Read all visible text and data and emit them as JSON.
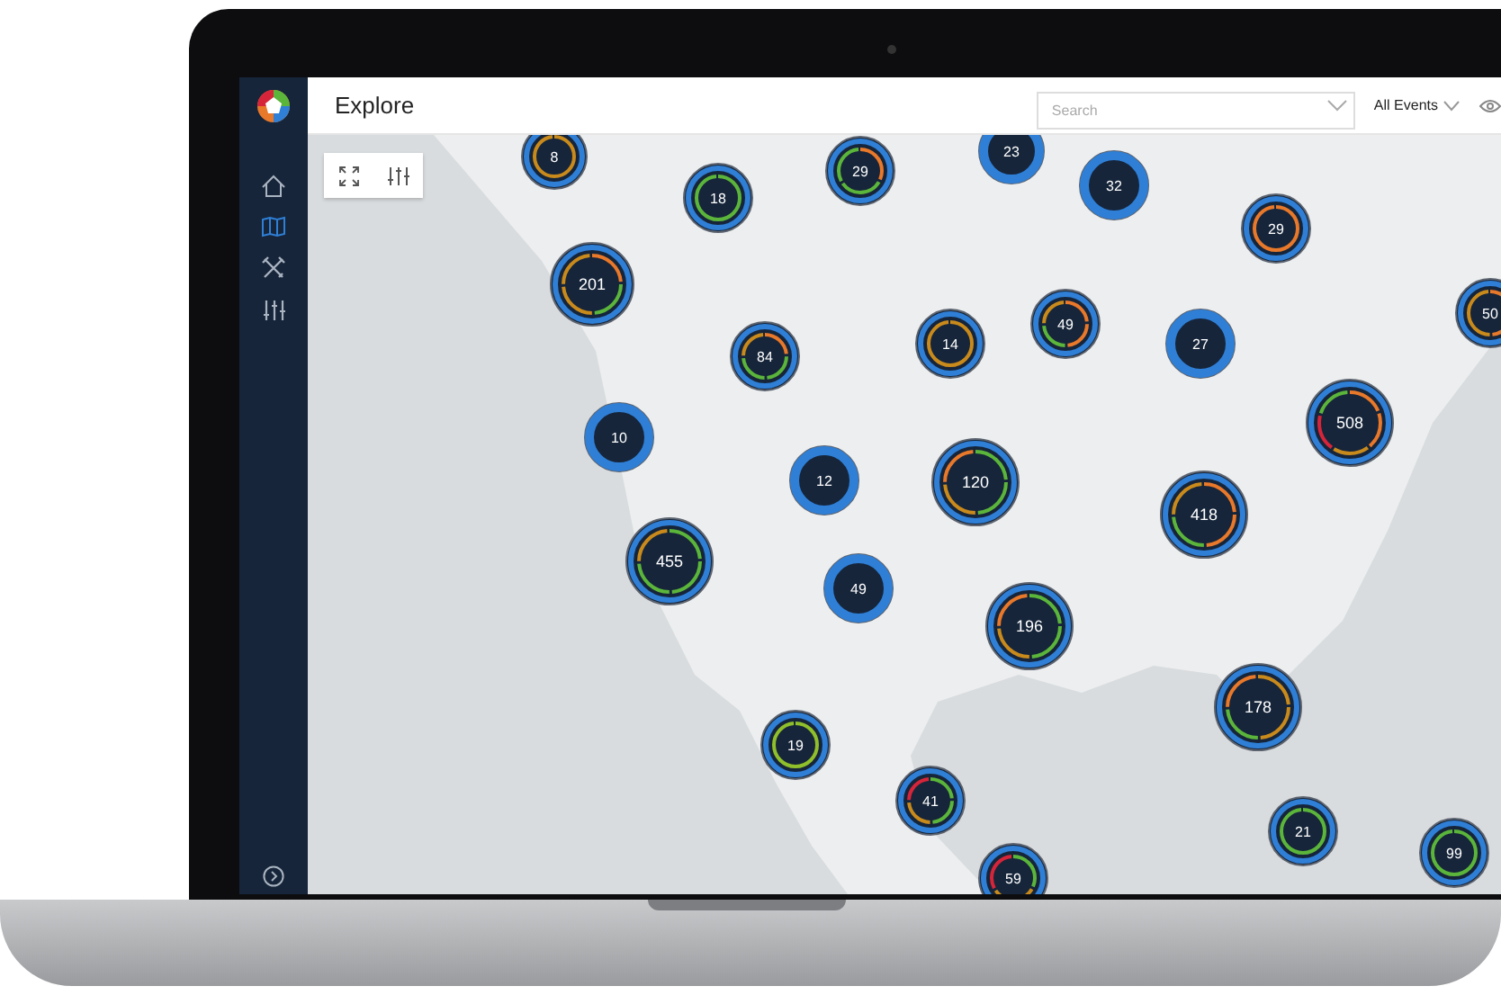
{
  "app": {
    "title": "Explore"
  },
  "search": {
    "placeholder": "Search"
  },
  "filter": {
    "label": "All Events"
  },
  "clusters": [
    {
      "count": "8",
      "segments": [
        {
          "color": "#c98a1c"
        }
      ]
    },
    {
      "count": "18",
      "segments": [
        {
          "color": "#5bb53b"
        }
      ]
    },
    {
      "count": "29",
      "segments": [
        {
          "color": "#e8782a"
        },
        {
          "color": "#5bb53b"
        },
        {
          "color": "#5bb53b"
        }
      ]
    },
    {
      "count": "23"
    },
    {
      "count": "32"
    },
    {
      "count": "29",
      "segments": [
        {
          "color": "#e8782a"
        }
      ]
    },
    {
      "count": "201",
      "segments": [
        {
          "color": "#e8782a"
        },
        {
          "color": "#5bb53b"
        },
        {
          "color": "#c98a1c"
        },
        {
          "color": "#c98a1c"
        }
      ]
    },
    {
      "count": "84",
      "segments": [
        {
          "color": "#e8782a"
        },
        {
          "color": "#5bb53b"
        },
        {
          "color": "#5bb53b"
        },
        {
          "color": "#c98a1c"
        }
      ]
    },
    {
      "count": "14",
      "segments": [
        {
          "color": "#c98a1c"
        }
      ]
    },
    {
      "count": "49",
      "segments": [
        {
          "color": "#e8782a"
        },
        {
          "color": "#e8782a"
        },
        {
          "color": "#5bb53b"
        },
        {
          "color": "#c98a1c"
        }
      ]
    },
    {
      "count": "27"
    },
    {
      "count": "508",
      "segments": [
        {
          "color": "#e8782a"
        },
        {
          "color": "#e8782a"
        },
        {
          "color": "#c98a1c"
        },
        {
          "color": "#d6253a"
        },
        {
          "color": "#5bb53b"
        }
      ]
    },
    {
      "count": "50",
      "segments": [
        {
          "color": "#e8782a"
        },
        {
          "color": "#c98a1c"
        }
      ]
    },
    {
      "count": "10"
    },
    {
      "count": "12"
    },
    {
      "count": "120",
      "segments": [
        {
          "color": "#5bb53b"
        },
        {
          "color": "#5bb53b"
        },
        {
          "color": "#c98a1c"
        },
        {
          "color": "#e8782a"
        }
      ]
    },
    {
      "count": "418",
      "segments": [
        {
          "color": "#e8782a"
        },
        {
          "color": "#e8782a"
        },
        {
          "color": "#5bb53b"
        },
        {
          "color": "#c98a1c"
        }
      ]
    },
    {
      "count": "455",
      "segments": [
        {
          "color": "#5bb53b"
        },
        {
          "color": "#5bb53b"
        },
        {
          "color": "#5bb53b"
        },
        {
          "color": "#c98a1c"
        }
      ]
    },
    {
      "count": "49"
    },
    {
      "count": "196",
      "segments": [
        {
          "color": "#5bb53b"
        },
        {
          "color": "#5bb53b"
        },
        {
          "color": "#c98a1c"
        },
        {
          "color": "#e8782a"
        }
      ]
    },
    {
      "count": "178",
      "segments": [
        {
          "color": "#c98a1c"
        },
        {
          "color": "#c98a1c"
        },
        {
          "color": "#5bb53b"
        },
        {
          "color": "#e8782a"
        }
      ]
    },
    {
      "count": "19",
      "segments": [
        {
          "color": "#8fbf2a"
        }
      ]
    },
    {
      "count": "41",
      "segments": [
        {
          "color": "#5bb53b"
        },
        {
          "color": "#5bb53b"
        },
        {
          "color": "#c98a1c"
        },
        {
          "color": "#d6253a"
        }
      ]
    },
    {
      "count": "21",
      "segments": [
        {
          "color": "#5bb53b"
        }
      ]
    },
    {
      "count": "99",
      "segments": [
        {
          "color": "#5bb53b"
        }
      ]
    },
    {
      "count": "59",
      "segments": [
        {
          "color": "#5bb53b"
        },
        {
          "color": "#c98a1c"
        },
        {
          "color": "#d6253a"
        }
      ]
    }
  ]
}
